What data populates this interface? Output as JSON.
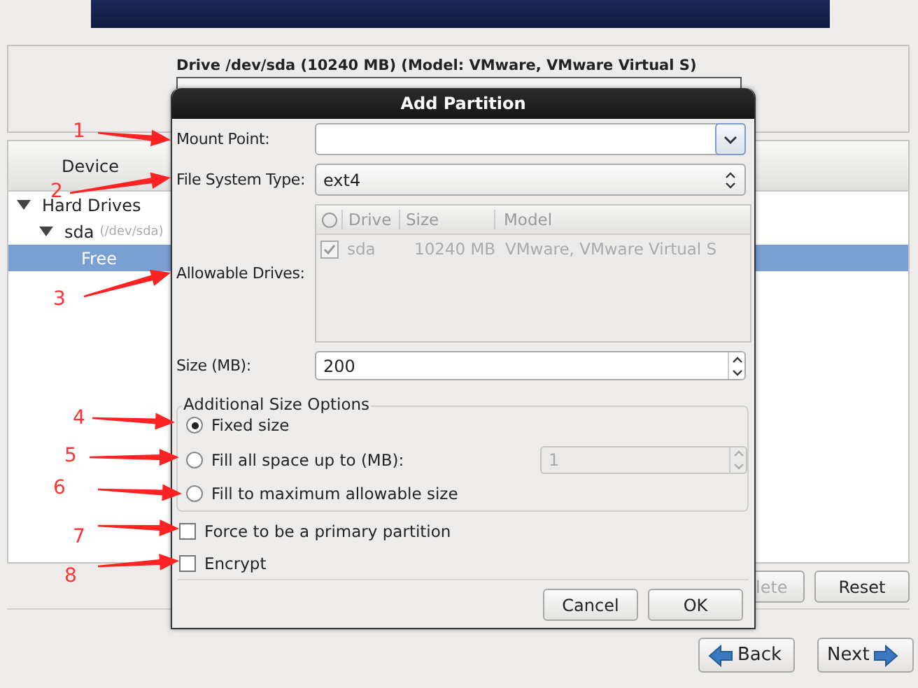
{
  "drive_panel": {
    "title": "Drive /dev/sda (10240 MB) (Model: VMware, VMware Virtual S)"
  },
  "device_panel": {
    "column": "Device",
    "tree": [
      {
        "label": "Hard Drives",
        "expanded": true,
        "selected": false,
        "children": [
          {
            "label": "sda",
            "detail": "(/dev/sda)",
            "expanded": true,
            "selected": false,
            "children": [
              {
                "label": "Free",
                "selected": true
              }
            ]
          }
        ]
      }
    ]
  },
  "panel_buttons": [
    {
      "label": "lete",
      "disabled": true
    },
    {
      "label": "Reset",
      "disabled": false
    }
  ],
  "nav_buttons": [
    {
      "label": "Back",
      "kind": "back"
    },
    {
      "label": "Next",
      "kind": "next"
    }
  ],
  "dialog": {
    "title": "Add Partition",
    "mount_point": {
      "label": "Mount Point:"
    },
    "fs_type": {
      "label": "File System Type:",
      "value": "ext4"
    },
    "allowable_drives": {
      "label": "Allowable Drives:",
      "disabled": true,
      "columns": [
        "Drive",
        "Size",
        "Model"
      ],
      "rows": [
        {
          "checked": true,
          "drive": "sda",
          "size": "10240 MB",
          "model": "VMware, VMware Virtual S"
        }
      ]
    },
    "size": {
      "label": "Size (MB):",
      "value": "200"
    },
    "size_options": {
      "title": "Additional Size Options",
      "fill_value": "1",
      "fill_disabled": true,
      "options": [
        {
          "label": "Fixed size",
          "selected": true
        },
        {
          "label": "Fill all space up to (MB):",
          "selected": false
        },
        {
          "label": "Fill to maximum allowable size",
          "selected": false
        }
      ]
    },
    "checks": [
      {
        "label": "Force to be a primary partition",
        "checked": false
      },
      {
        "label": "Encrypt",
        "checked": false
      }
    ],
    "buttons": [
      "Cancel",
      "OK"
    ]
  },
  "annotations": [
    {
      "number": "1"
    },
    {
      "number": "2"
    },
    {
      "number": "3"
    },
    {
      "number": "4"
    },
    {
      "number": "5"
    },
    {
      "number": "6"
    },
    {
      "number": "7"
    },
    {
      "number": "8"
    }
  ]
}
